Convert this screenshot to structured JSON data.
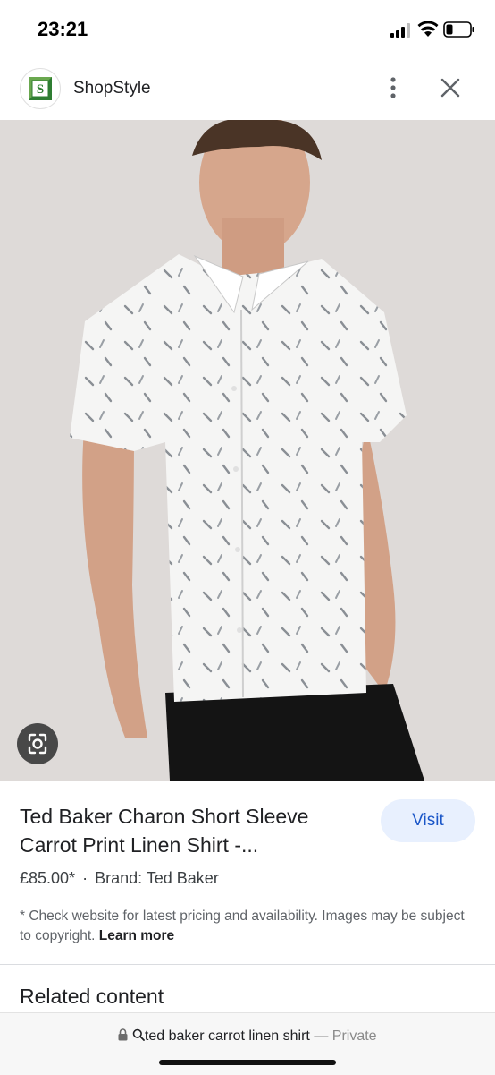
{
  "status_bar": {
    "time": "23:21",
    "battery_level": 0.25
  },
  "header": {
    "logo_letter": "S",
    "site_name": "ShopStyle",
    "more_icon": "more-vert-icon",
    "close_icon": "close-icon"
  },
  "product": {
    "image_description_icon": "lens-icon",
    "title_line1": "Ted Baker Charon Short Sleeve",
    "title_line2": "Carrot Print Linen Shirt -...",
    "visit_label": "Visit",
    "price": "£85.00*",
    "separator": "·",
    "brand": "Brand: Ted Baker",
    "disclaimer": "* Check website for latest pricing and availability. Images may be subject to copyright.",
    "learn_more": "Learn more"
  },
  "related": {
    "heading": "Related content"
  },
  "url_bar": {
    "query": "ted baker carrot linen shirt",
    "dash": "—",
    "private": "Private"
  },
  "colors": {
    "accent": "#1a56c8",
    "visit_bg": "#e8f0fe",
    "logo_green": "#2e7d32"
  }
}
